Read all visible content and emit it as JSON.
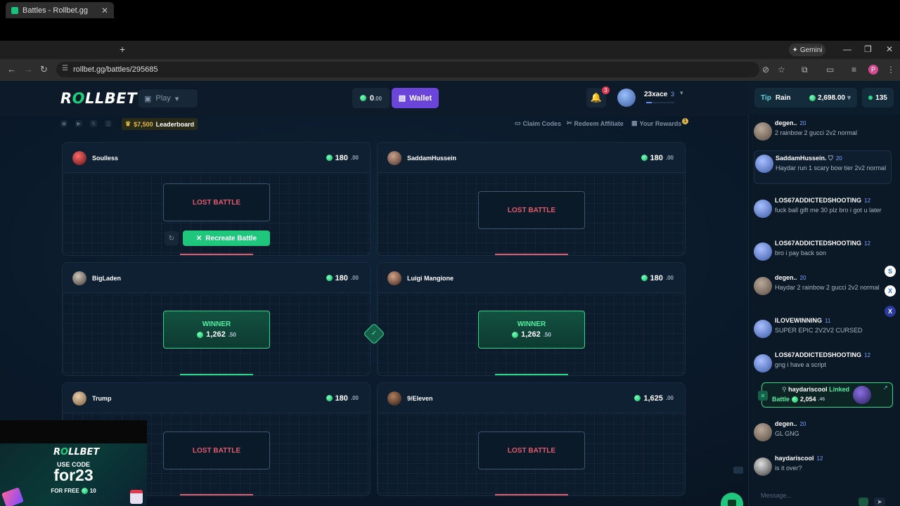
{
  "browser": {
    "tab_title": "Battles - Rollbet.gg",
    "url": "rollbet.gg/battles/295685",
    "gemini_label": "Gemini",
    "profile_initial": "P"
  },
  "header": {
    "logo_pre": "R",
    "logo_o": "O",
    "logo_post": "LLBET",
    "play_label": "Play",
    "balance_int": "0",
    "balance_dec": ".00",
    "wallet_label": "Wallet",
    "notif_count": "3",
    "username": "23xace",
    "user_level": "3",
    "xp_progress": 0.2
  },
  "subbar": {
    "leaderboard_amount": "$7,500",
    "leaderboard_label": "Leaderboard",
    "claim_codes": "Claim Codes",
    "redeem_affiliate": "Redeem Affiliate",
    "your_rewards": "Your Rewards",
    "rewards_badge": "1"
  },
  "battles": [
    {
      "player": "Soulless",
      "amount_int": "180",
      "amount_dec": ".00",
      "result": "LOST BATTLE"
    },
    {
      "player": "SaddamHussein",
      "amount_int": "180",
      "amount_dec": ".00",
      "result": "LOST BATTLE"
    },
    {
      "player": "BigLaden",
      "amount_int": "180",
      "amount_dec": ".00",
      "result": "WINNER",
      "win_int": "1,262",
      "win_dec": ".50"
    },
    {
      "player": "Luigi Mangione",
      "amount_int": "180",
      "amount_dec": ".00",
      "result": "WINNER",
      "win_int": "1,262",
      "win_dec": ".50"
    },
    {
      "player": "Trump",
      "amount_int": "180",
      "amount_dec": ".00",
      "result": "LOST BATTLE"
    },
    {
      "player": "9/Eleven",
      "amount_int": "1,625",
      "amount_dec": ".00",
      "result": "LOST BATTLE"
    }
  ],
  "recreate_label": "Recreate Battle",
  "promo": {
    "logo_pre": "R",
    "logo_o": "O",
    "logo_post": "LLBET",
    "use_code": "USE CODE",
    "code": "for23",
    "for_free": "FOR FREE",
    "free_amount": "10"
  },
  "chat": {
    "tip": "Tip",
    "rain": "Rain",
    "rain_value": "2,698.00",
    "online_count": "135",
    "messages": [
      {
        "name": "degen..",
        "level": "20",
        "text": "2 rainbow 2 gucci 2v2 normal"
      },
      {
        "name": "SaddamHussein.",
        "level": "20",
        "text": "Haydar run 1 scary bow tier 2v2 normal"
      },
      {
        "name": "LOS67ADDICTEDSHOOTING",
        "level": "12",
        "text": "fuck ball gift me 30 plz bro i got u later"
      },
      {
        "name": "LOS67ADDICTEDSHOOTING",
        "level": "12",
        "text": "bro i pay back son"
      },
      {
        "name": "degen..",
        "level": "20",
        "text": "Haydar 2 rainbow 2 gucci 2v2 normal"
      },
      {
        "name": "ILOVEWINNING",
        "level": "11",
        "text": "SUPER EPIC 2V2V2 CURSED"
      },
      {
        "name": "LOS67ADDICTEDSHOOTING",
        "level": "12",
        "text": "gng i have a script"
      },
      {
        "name": "degen..",
        "level": "20",
        "text": "GL GNG"
      },
      {
        "name": "haydariscool",
        "level": "12",
        "text": "is it over?"
      }
    ],
    "linked": {
      "name": "haydariscool",
      "linked_word": "Linked",
      "battle_word": "Battle",
      "value_int": "2,054",
      "value_dec": ".46"
    },
    "input_placeholder": "Message...",
    "side_s": "S",
    "side_x1": "X",
    "side_x2": "X"
  }
}
